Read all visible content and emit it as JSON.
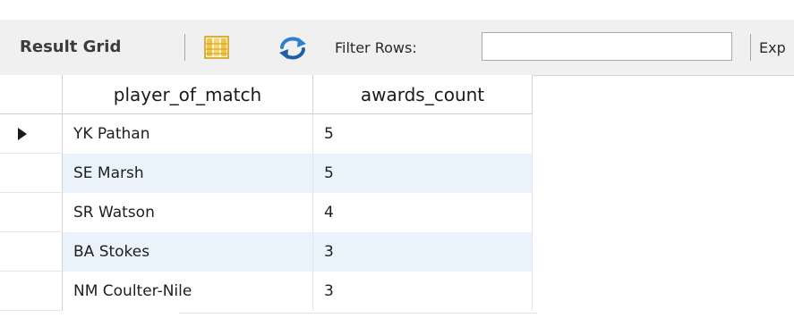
{
  "toolbar": {
    "title": "Result Grid",
    "filter_label": "Filter Rows:",
    "filter_value": "",
    "export_label": "Exp"
  },
  "grid": {
    "columns": [
      "player_of_match",
      "awards_count"
    ],
    "rows": [
      {
        "player_of_match": "YK Pathan",
        "awards_count": "5"
      },
      {
        "player_of_match": "SE Marsh",
        "awards_count": "5"
      },
      {
        "player_of_match": "SR Watson",
        "awards_count": "4"
      },
      {
        "player_of_match": "BA Stokes",
        "awards_count": "3"
      },
      {
        "player_of_match": "NM Coulter-Nile",
        "awards_count": "3"
      }
    ],
    "selected_row": 0
  },
  "colors": {
    "toolbar_bg": "#f0f0f0",
    "alt_row_bg": "#eaf2fb",
    "refresh_icon": "#2f7fd0"
  }
}
